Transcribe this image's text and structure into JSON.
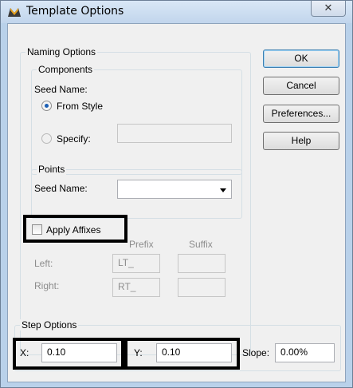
{
  "window": {
    "title": "Template Options",
    "close_glyph": "✕"
  },
  "naming": {
    "label": "Naming Options",
    "components": {
      "label": "Components",
      "seed_name_label": "Seed Name:",
      "from_style_label": "From Style",
      "specify_label": "Specify:",
      "specify_value": ""
    },
    "points": {
      "label": "Points",
      "seed_name_label": "Seed Name:",
      "seed_name_value": ""
    },
    "apply_affixes_label": "Apply Affixes",
    "apply_affixes_checked": false,
    "prefix_header": "Prefix",
    "suffix_header": "Suffix",
    "left_label": "Left:",
    "right_label": "Right:",
    "left_prefix": "LT_",
    "right_prefix": "RT_",
    "left_suffix": "",
    "right_suffix": ""
  },
  "buttons": {
    "ok": "OK",
    "cancel": "Cancel",
    "preferences": "Preferences...",
    "help": "Help"
  },
  "step": {
    "label": "Step Options",
    "x_label": "X:",
    "x_value": "0.10",
    "y_label": "Y:",
    "y_value": "0.10",
    "slope_label": "Slope:",
    "slope_value": "0.00%"
  },
  "colors": {
    "title_bg": "#c1d5ec",
    "dialog_bg": "#f0f0f0",
    "highlight": "#000000"
  }
}
